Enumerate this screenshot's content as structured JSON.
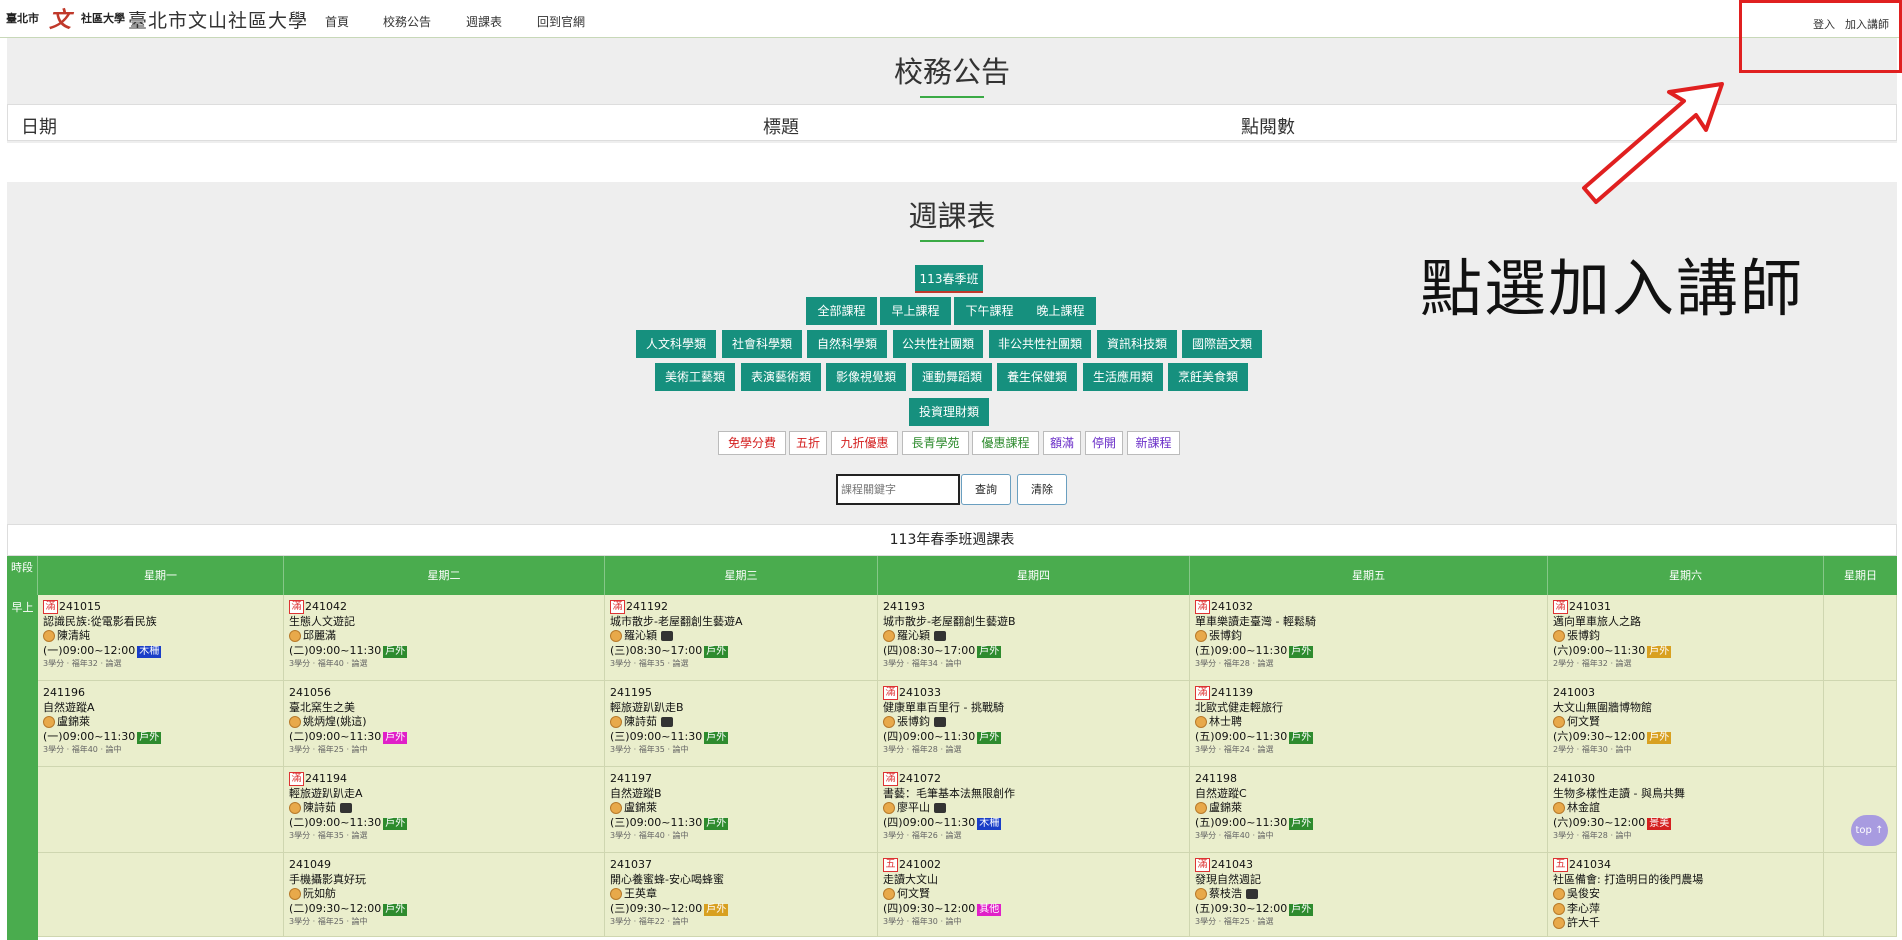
{
  "header": {
    "logo_text": "臺北市",
    "logo_text2": "社區大學",
    "site_title": "臺北市文山社區大學",
    "nav": [
      "首頁",
      "校務公告",
      "週課表",
      "回到官網"
    ],
    "login": "登入",
    "join_teacher": "加入講師"
  },
  "annotation": {
    "text": "點選加入講師"
  },
  "announcements": {
    "title": "校務公告",
    "columns": [
      "日期",
      "標題",
      "點閱數"
    ]
  },
  "weekly": {
    "title": "週課表",
    "season_button": "113春季班",
    "time_buttons": [
      "全部課程",
      "早上課程",
      "下午課程",
      "晚上課程"
    ],
    "category_row1": [
      "人文科學類",
      "社會科學類",
      "自然科學類",
      "公共性社團類",
      "非公共性社團類",
      "資訊科技類",
      "國際語文類"
    ],
    "category_row2": [
      "美術工藝類",
      "表演藝術類",
      "影像視覺類",
      "運動舞蹈類",
      "養生保健類",
      "生活應用類",
      "烹飪美食類"
    ],
    "category_row3": [
      "投資理財類"
    ],
    "tags": [
      "免學分費",
      "五折",
      "九折優惠",
      "長青學苑",
      "優惠課程",
      "額滿",
      "停開",
      "新課程"
    ],
    "search_placeholder": "課程關鍵字",
    "search_button": "查詢",
    "clear_button": "清除"
  },
  "schedule": {
    "caption": "113年春季班週課表",
    "slot_header": "時段",
    "slot_label": "早上",
    "days": [
      "星期一",
      "星期二",
      "星期三",
      "星期四",
      "星期五",
      "星期六",
      "星期日"
    ],
    "top_button": "top ↑",
    "rows": [
      [
        {
          "id": "241015",
          "full": "滿",
          "name": "認識民族:從電影看民族",
          "teacher": "陳清純",
          "time": "(一)09:00~12:00",
          "badge": "木柵",
          "meta": "3學分 · 福年32 · 論選"
        },
        {
          "id": "241042",
          "full": "滿",
          "name": "生態人文遊記",
          "teacher": "邱麗滿",
          "time": "(二)09:00~11:30",
          "badge": "戶外",
          "meta": "3學分 · 福年40 · 論選"
        },
        {
          "id": "241192",
          "full": "滿",
          "name": "城市散步-老屋翻創生藝遊A",
          "teacher": "羅沁穎",
          "time": "(三)08:30~17:00",
          "badge": "戶外",
          "meta": "3學分 · 福年35 · 論選"
        },
        {
          "id": "241193",
          "full": "",
          "name": "城市散步-老屋翻創生藝遊B",
          "teacher": "羅沁穎",
          "time": "(四)08:30~17:00",
          "badge": "戶外",
          "meta": "3學分 · 福年34 · 論中"
        },
        {
          "id": "241032",
          "full": "滿",
          "name": "單車樂讀走臺灣 - 輕鬆騎",
          "teacher": "張博鈞",
          "time": "(五)09:00~11:30",
          "badge": "戶外",
          "meta": "3學分 · 福年28 · 論選"
        },
        {
          "id": "241031",
          "full": "滿",
          "name": "邁向單車旅人之路",
          "teacher": "張博鈞",
          "time": "(六)09:00~11:30",
          "badge": "戶外",
          "meta": "2學分 · 福年32 · 論選"
        },
        null
      ],
      [
        {
          "id": "241196",
          "full": "",
          "name": "自然遊蹤A",
          "teacher": "盧錦萊",
          "time": "(一)09:00~11:30",
          "badge": "戶外",
          "meta": "3學分 · 福年40 · 論中"
        },
        {
          "id": "241056",
          "full": "",
          "name": "臺北窯生之美",
          "teacher": "姚炳煌(姚這)",
          "time": "(二)09:00~11:30",
          "badge": "戶外",
          "meta": "3學分 · 福年25 · 論中"
        },
        {
          "id": "241195",
          "full": "",
          "name": "輕旅遊趴趴走B",
          "teacher": "陳詩茹",
          "time": "(三)09:00~11:30",
          "badge": "戶外",
          "meta": "3學分 · 福年35 · 論中"
        },
        {
          "id": "241033",
          "full": "滿",
          "name": "健康單車百里行 - 挑戰騎",
          "teacher": "張博鈞",
          "time": "(四)09:00~11:30",
          "badge": "戶外",
          "meta": "3學分 · 福年28 · 論選"
        },
        {
          "id": "241139",
          "full": "滿",
          "name": "北歐式健走輕旅行",
          "teacher": "林士聘",
          "time": "(五)09:00~11:30",
          "badge": "戶外",
          "meta": "3學分 · 福年24 · 論選"
        },
        {
          "id": "241003",
          "full": "",
          "name": "大文山無圍牆博物館",
          "teacher": "何文賢",
          "time": "(六)09:30~12:00",
          "badge": "戶外",
          "meta": "2學分 · 福年30 · 論中"
        },
        null
      ],
      [
        null,
        {
          "id": "241194",
          "full": "滿",
          "name": "輕旅遊趴趴走A",
          "teacher": "陳詩茹",
          "time": "(二)09:00~11:30",
          "badge": "戶外",
          "meta": "3學分 · 福年35 · 論選"
        },
        {
          "id": "241197",
          "full": "",
          "name": "自然遊蹤B",
          "teacher": "盧錦萊",
          "time": "(三)09:00~11:30",
          "badge": "戶外",
          "meta": "3學分 · 福年40 · 論中"
        },
        {
          "id": "241072",
          "full": "滿",
          "name": "書藝：毛筆基本法無限創作",
          "teacher": "廖平山",
          "time": "(四)09:00~11:30",
          "badge": "木柵",
          "meta": "3學分 · 福年26 · 論選"
        },
        {
          "id": "241198",
          "full": "",
          "name": "自然遊蹤C",
          "teacher": "盧錦萊",
          "time": "(五)09:00~11:30",
          "badge": "戶外",
          "meta": "3學分 · 福年40 · 論中"
        },
        {
          "id": "241030",
          "full": "",
          "name": "生物多樣性走讀 - 與鳥共舞",
          "teacher": "林金誼",
          "time": "(六)09:30~12:00",
          "badge": "景美",
          "meta": "3學分 · 福年28 · 論中"
        },
        null
      ],
      [
        null,
        {
          "id": "241049",
          "full": "",
          "name": "手機攝影真好玩",
          "teacher": "阮如舫",
          "time": "(二)09:30~12:00",
          "badge": "戶外",
          "meta": "3學分 · 福年25 · 論中"
        },
        {
          "id": "241037",
          "full": "",
          "name": "開心養蜜蜂-安心喝蜂蜜",
          "teacher": "王英章",
          "time": "(三)09:30~12:00",
          "badge": "戶外",
          "meta": "3學分 · 福年22 · 論中"
        },
        {
          "id": "241002",
          "full": "五",
          "name": "走讀大文山",
          "teacher": "何文賢",
          "time": "(四)09:30~12:00",
          "badge": "其他",
          "meta": "3學分 · 福年30 · 論中"
        },
        {
          "id": "241043",
          "full": "滿",
          "name": "發現自然週記",
          "teacher": "蔡枝浩",
          "time": "(五)09:30~12:00",
          "badge": "戶外",
          "meta": "3學分 · 福年25 · 論選"
        },
        {
          "id": "241034",
          "full": "五",
          "name": "社區備會: 打造明日的後門農場",
          "teacher": "吳俊安",
          "teacher2": "李心萍",
          "teacher3": "許大千",
          "time": "",
          "badge": "",
          "meta": ""
        },
        null
      ]
    ]
  },
  "colors": {
    "teal": "#16907e",
    "green_header": "#4aac4e",
    "cell_bg": "#eaeecc",
    "badge_outdoor": "#2e8b2e",
    "badge_muzha": "#1a3ec8",
    "badge_jingmei": "#d42020",
    "badge_other": "#e020c8",
    "badge_gold": "#d8a020",
    "annotation_red": "#e02020"
  }
}
